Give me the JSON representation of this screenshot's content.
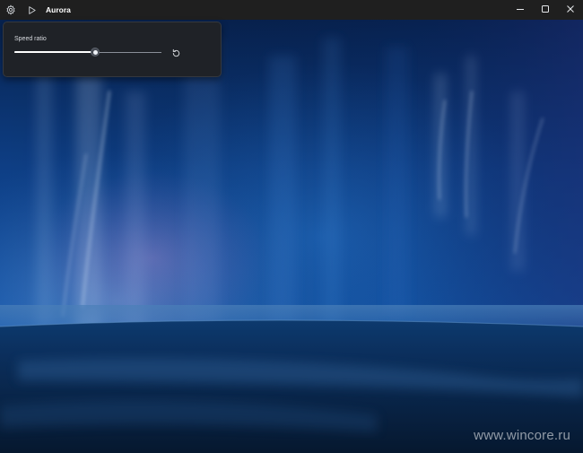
{
  "window": {
    "title": "Aurora"
  },
  "titlebar": {
    "icons": {
      "settings": "gear-icon",
      "play": "play-icon",
      "minimize": "minimize-icon",
      "maximize": "maximize-icon",
      "close": "close-icon"
    }
  },
  "panel": {
    "label": "Speed ratio",
    "slider_value_fraction": 0.55,
    "reset_icon": "reset-icon"
  },
  "watermark": {
    "text": "www.wincore.ru"
  },
  "colors": {
    "titlebar_bg": "#1f1f1f",
    "panel_bg": "#1f2227",
    "sky_top": "#06214d",
    "sky_mid": "#1152a6",
    "ground": "#0a2448"
  }
}
